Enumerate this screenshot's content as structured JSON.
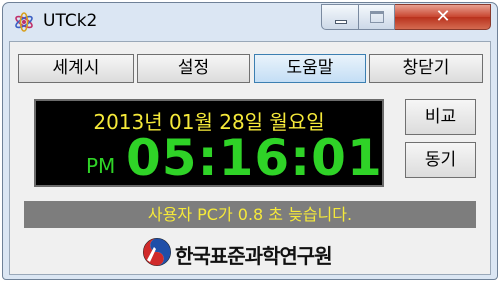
{
  "window": {
    "title": "UTCk2",
    "min_icon": "minimize-icon",
    "max_icon": "maximize-icon",
    "close_icon": "close-icon",
    "close_glyph": "✕"
  },
  "tabs": [
    {
      "label": "세계시"
    },
    {
      "label": "설정"
    },
    {
      "label": "도움말",
      "active": true
    },
    {
      "label": "창닫기"
    }
  ],
  "clock": {
    "date": "2013년 01월 28일 월요일",
    "ampm": "PM",
    "time": "05:16:01",
    "date_color": "#f5e93a",
    "time_color": "#2fd327"
  },
  "buttons": {
    "compare": "비교",
    "sync": "동기"
  },
  "status": {
    "message": "사용자 PC가 0.8 초 늦습니다.",
    "color": "#f5e93a",
    "background": "#7d7d7d"
  },
  "logo": {
    "text": "한국표준과학연구원",
    "icon": "kriss-emblem-icon"
  }
}
